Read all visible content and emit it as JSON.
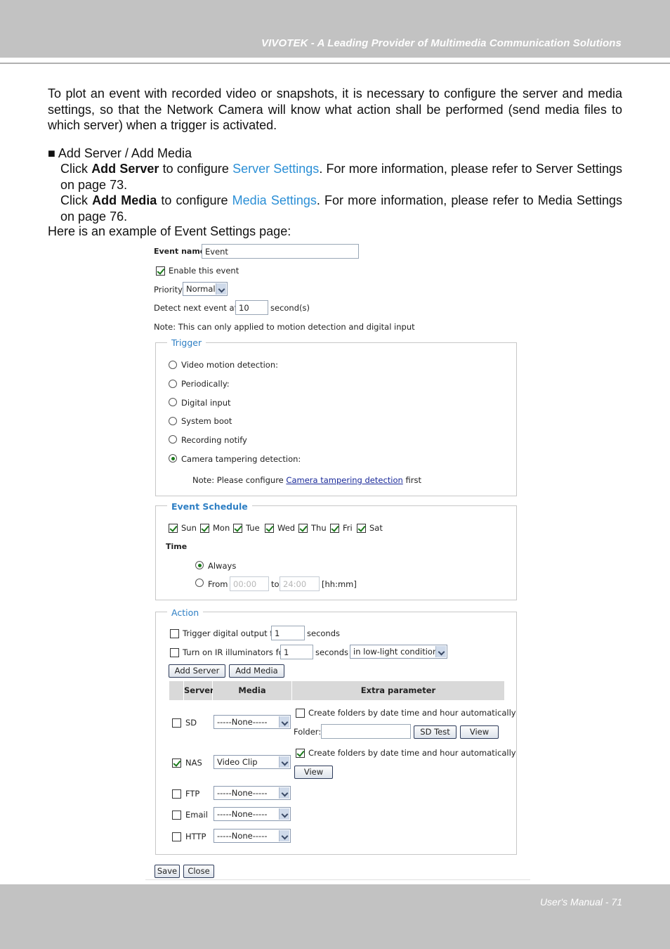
{
  "header": {
    "title": "VIVOTEK - A Leading Provider of Multimedia Communication Solutions"
  },
  "footer": {
    "page": "User's Manual - 71"
  },
  "intro": "To plot an event with recorded video or snapshots, it is necessary to configure the server and media settings, so that the Network Camera will know what action shall be performed (send media files to which server) when a trigger is activated.",
  "bullet_title": "■ Add Server / Add Media",
  "line1": {
    "pre": "Click ",
    "bold": "Add Server",
    "mid": " to configure ",
    "link": "Server Settings",
    "post": ". For more information, please refer to Server Settings on page 73."
  },
  "line2": {
    "pre": "Click ",
    "bold": "Add Media",
    "mid": " to configure ",
    "link": "Media Settings",
    "post": ". For more information, please refer to Media Settings on page 76."
  },
  "example_label": "Here is an example of Event Settings page:",
  "form": {
    "event_name_label": "Event name:",
    "event_name_value": "Event",
    "enable_label": "Enable this event",
    "priority_label": "Priority:",
    "priority_value": "Normal",
    "detect_label": "Detect next event after",
    "detect_value": "10",
    "detect_unit": "second(s)",
    "note": "Note: This can only applied to motion detection and digital input"
  },
  "trigger": {
    "legend": "Trigger",
    "options": [
      "Video motion detection:",
      "Periodically:",
      "Digital input",
      "System boot",
      "Recording notify",
      "Camera tampering detection:"
    ],
    "note_pre": "Note: Please configure ",
    "note_link": "Camera tampering detection",
    "note_post": " first"
  },
  "schedule": {
    "legend": "Event Schedule",
    "days": [
      "Sun",
      "Mon",
      "Tue",
      "Wed",
      "Thu",
      "Fri",
      "Sat"
    ],
    "time_label": "Time",
    "always": "Always",
    "from": "From",
    "from_value": "00:00",
    "to": "to",
    "to_value": "24:00",
    "unit": "[hh:mm]"
  },
  "action": {
    "legend": "Action",
    "trigger_do_label": "Trigger digital output for",
    "trigger_do_value": "1",
    "trigger_do_unit": "seconds",
    "ir_label": "Turn on IR illuminators for",
    "ir_value": "1",
    "ir_unit": "seconds",
    "ir_condition": "in low-light conditions",
    "add_server": "Add Server",
    "add_media": "Add Media",
    "col_server": "Server",
    "col_media": "Media",
    "col_extra": "Extra parameter",
    "rows": [
      {
        "name": "SD",
        "media": "-----None-----"
      },
      {
        "name": "NAS",
        "media": "Video Clip"
      },
      {
        "name": "FTP",
        "media": "-----None-----"
      },
      {
        "name": "Email",
        "media": "-----None-----"
      },
      {
        "name": "HTTP",
        "media": "-----None-----"
      }
    ],
    "create_folders": "Create folders by date time and hour automatically",
    "folder_label": "Folder:",
    "sd_test": "SD Test",
    "view": "View"
  },
  "buttons": {
    "save": "Save",
    "close": "Close"
  }
}
